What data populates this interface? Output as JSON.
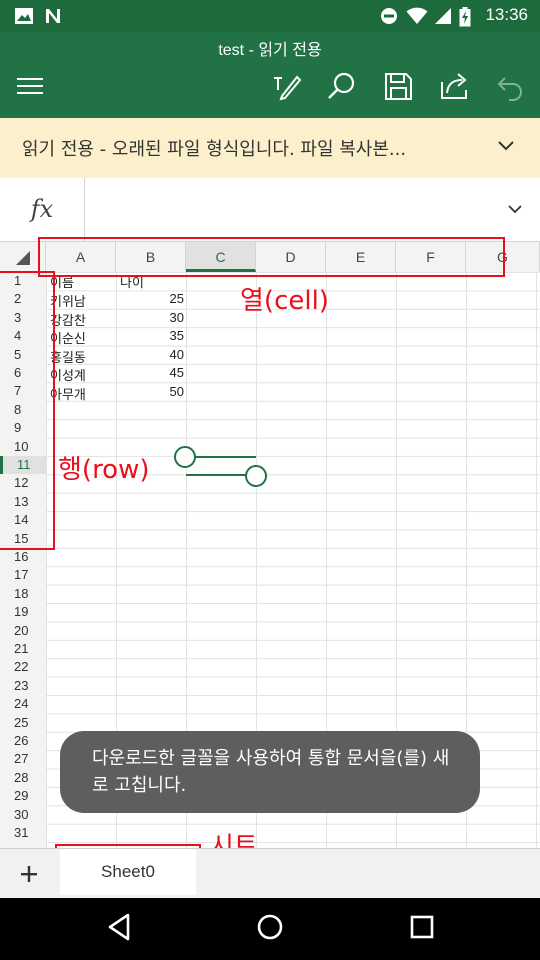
{
  "status_bar": {
    "time": "13:36"
  },
  "app_bar": {
    "title": "test - 읽기 전용"
  },
  "banner": {
    "text": "읽기 전용 - 오래된 파일 형식입니다. 파일 복사본..."
  },
  "formula_bar": {
    "label": "fx",
    "value": ""
  },
  "grid": {
    "columns": [
      "A",
      "B",
      "C",
      "D",
      "E",
      "F",
      "G"
    ],
    "selected_column": "C",
    "rows": [
      "1",
      "2",
      "3",
      "4",
      "5",
      "6",
      "7",
      "8",
      "9",
      "10",
      "11",
      "12",
      "13",
      "14",
      "15",
      "16",
      "17",
      "18",
      "19",
      "20",
      "21",
      "22",
      "23",
      "24",
      "25",
      "26",
      "27",
      "28",
      "29",
      "30",
      "31"
    ],
    "selected_row": "11",
    "cells": {
      "A1": "이름",
      "B1": "나이",
      "A2": "키위남",
      "B2": "25",
      "A3": "강감찬",
      "B3": "30",
      "A4": "이순신",
      "B4": "35",
      "A5": "홍길동",
      "B5": "40",
      "A6": "이성계",
      "B6": "45",
      "A7": "아무개",
      "B7": "50"
    }
  },
  "annotations": {
    "column_label": "열(cell)",
    "row_label": "행(row)",
    "sheet_label": "시트"
  },
  "toast": {
    "text": "다운로드한 글꼴을 사용하여 통합 문서을(를) 새로 고칩니다."
  },
  "sheet_tabs": {
    "tabs": [
      "Sheet0"
    ],
    "add_label": "+"
  },
  "colors": {
    "excel_green": "#217346",
    "status_green": "#1d6b3c",
    "banner_bg": "#fcf0cc",
    "annotation_red": "#e8101c",
    "toast_bg": "#5e5e5e"
  },
  "icons": [
    "image-icon",
    "n-icon",
    "dnd-icon",
    "wifi-icon",
    "signal-icon",
    "battery-icon",
    "menu-icon",
    "pen-icon",
    "search-icon",
    "save-icon",
    "share-icon",
    "undo-icon",
    "chevron-down-icon",
    "back-icon",
    "home-icon",
    "recents-icon"
  ]
}
